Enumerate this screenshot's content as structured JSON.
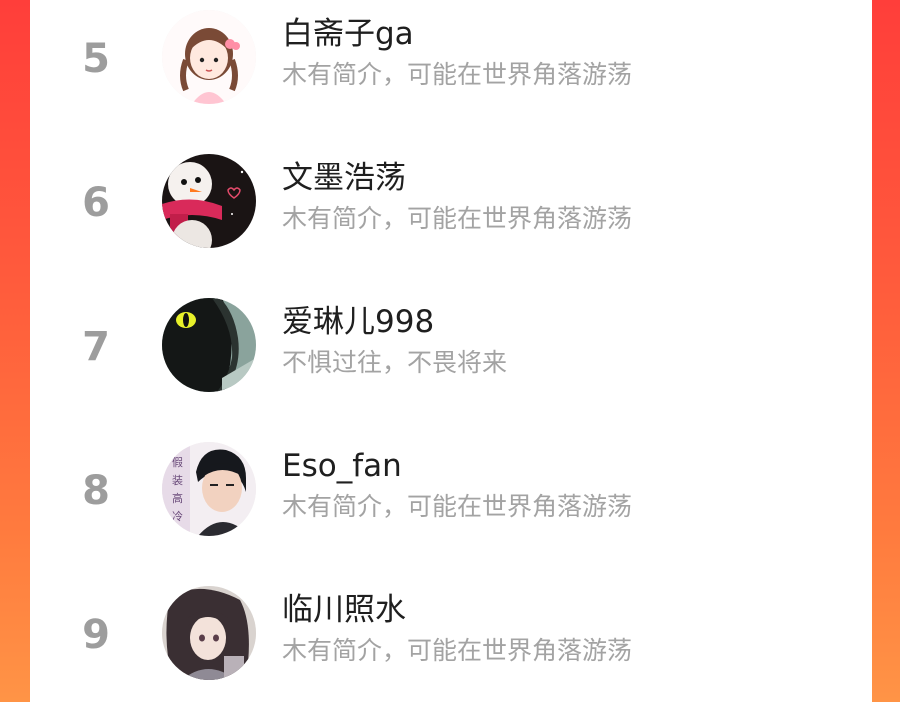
{
  "leaderboard": {
    "items": [
      {
        "rank": "5",
        "name": "白斋子ga",
        "bio": "木有简介，可能在世界角落游荡",
        "avatar_icon": "girl-cartoon-avatar"
      },
      {
        "rank": "6",
        "name": "文墨浩荡",
        "bio": "木有简介，可能在世界角落游荡",
        "avatar_icon": "snowman-avatar"
      },
      {
        "rank": "7",
        "name": "爱琳儿998",
        "bio": "不惧过往，不畏将来",
        "avatar_icon": "black-cat-avatar"
      },
      {
        "rank": "8",
        "name": "Eso_fan",
        "bio": "木有简介，可能在世界角落游荡",
        "avatar_icon": "man-portrait-avatar",
        "avatar_text": "假装高冷"
      },
      {
        "rank": "9",
        "name": "临川照水",
        "bio": "木有简介，可能在世界角落游荡",
        "avatar_icon": "anime-girl-avatar"
      }
    ]
  },
  "colors": {
    "background_top": "#ff3e3a",
    "background_bottom": "#ff9446",
    "rank_number": "#9d9d9d",
    "name_text": "#1f1f1f",
    "bio_text": "#a3a3a3"
  }
}
